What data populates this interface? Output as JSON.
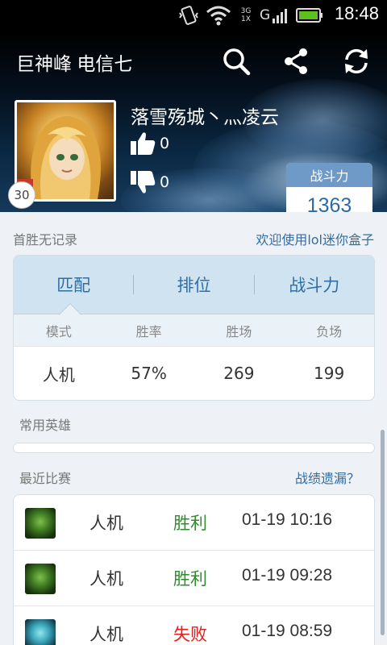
{
  "status_bar": {
    "time": "18:48",
    "network_label": "3G",
    "network_label_2": "1X",
    "signal_letter": "G",
    "icons": [
      "vibrate-icon",
      "wifi-icon",
      "signal-icon",
      "battery-icon"
    ]
  },
  "header": {
    "title": "巨神峰 电信七",
    "icons": [
      "search-icon",
      "share-icon",
      "refresh-icon"
    ]
  },
  "profile": {
    "name": "落雪殇城丶灬凌云",
    "level": "30",
    "likes": "0",
    "dislikes": "0",
    "power_label": "战斗力",
    "power_value": "1363"
  },
  "first_win": {
    "label": "首胜无记录",
    "link": "欢迎使用lol迷你盒子"
  },
  "stats": {
    "tabs": [
      "匹配",
      "排位",
      "战斗力"
    ],
    "selected_tab": 0,
    "columns": [
      "模式",
      "胜率",
      "胜场",
      "负场"
    ],
    "row": [
      "人机",
      "57%",
      "269",
      "199"
    ]
  },
  "heroes": {
    "label": "常用英雄"
  },
  "recent": {
    "label": "最近比赛",
    "link": "战绩遗漏？",
    "matches": [
      {
        "mode": "人机",
        "result": "胜利",
        "time": "01-19 10:16",
        "result_color": "#2e8b2e"
      },
      {
        "mode": "人机",
        "result": "胜利",
        "time": "01-19 09:28",
        "result_color": "#2e8b2e"
      },
      {
        "mode": "人机",
        "result": "失败",
        "time": "01-19 08:59",
        "result_color": "#e02020"
      }
    ]
  },
  "colors": {
    "accent": "#2f6ea6",
    "tab_bg": "#cfe3f1",
    "win": "#2e8b2e",
    "loss": "#e02020",
    "power_head": "#6f99c6"
  }
}
